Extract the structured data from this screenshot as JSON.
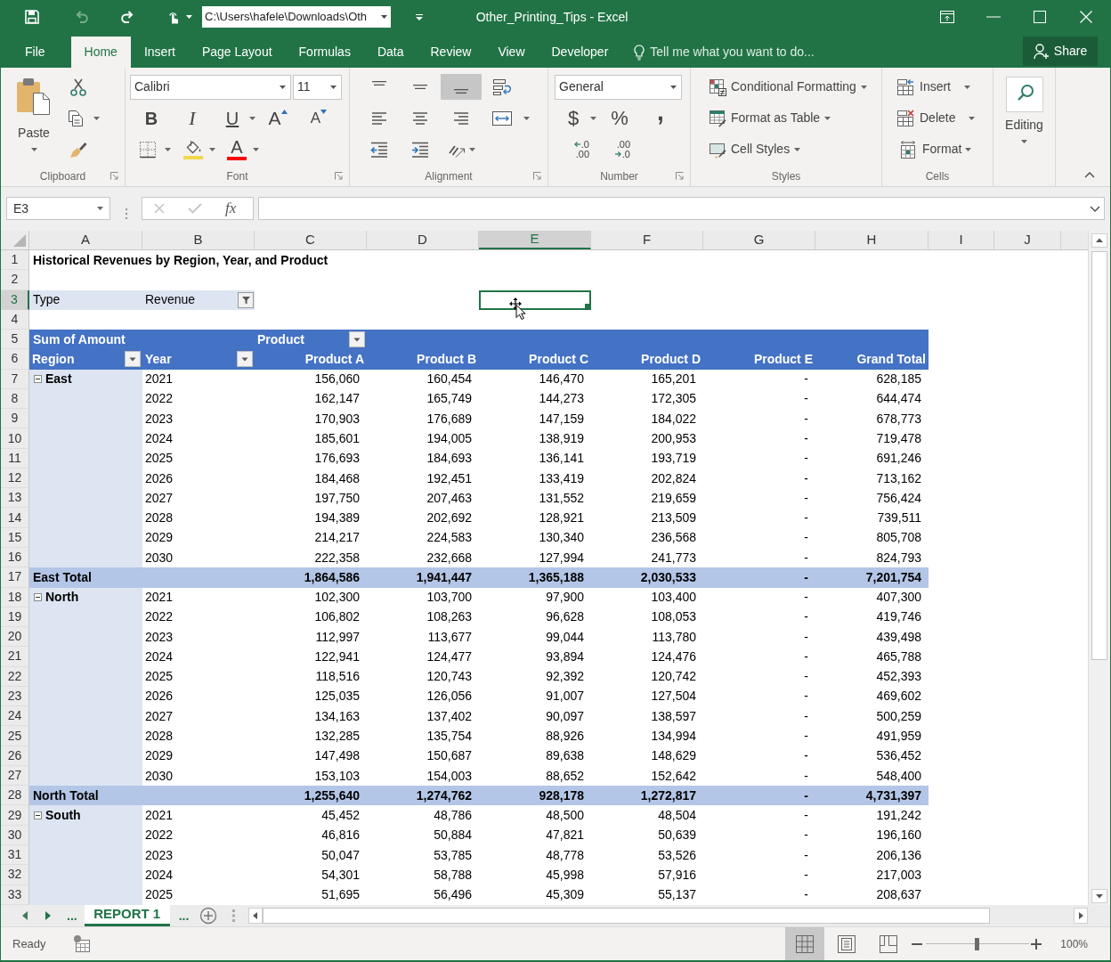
{
  "title_bar": {
    "quick_access": [
      {
        "kind": "save",
        "disabled": false
      },
      {
        "kind": "undo",
        "disabled": true
      },
      {
        "kind": "redo",
        "disabled": false
      },
      {
        "kind": "touch",
        "disabled": false
      }
    ],
    "path": "C:\\Users\\hafele\\Downloads\\Oth",
    "title": "Other_Printing_Tips - Excel"
  },
  "ribbon_tabs": [
    {
      "label": "File",
      "selected": false
    },
    {
      "label": "Home",
      "selected": true
    },
    {
      "label": "Insert",
      "selected": false
    },
    {
      "label": "Page Layout",
      "selected": false
    },
    {
      "label": "Formulas",
      "selected": false
    },
    {
      "label": "Data",
      "selected": false
    },
    {
      "label": "Review",
      "selected": false
    },
    {
      "label": "View",
      "selected": false
    },
    {
      "label": "Developer",
      "selected": false
    }
  ],
  "tell_me": {
    "placeholder": "Tell me what you want to do..."
  },
  "share_button": "Share",
  "ribbon": {
    "clipboard": {
      "label": "Clipboard",
      "paste": "Paste"
    },
    "font": {
      "label": "Font",
      "font_name": "Calibri",
      "font_size": "11",
      "buttons": [
        {
          "kind": "bold",
          "glyph": "B"
        },
        {
          "kind": "italic",
          "glyph": "I"
        },
        {
          "kind": "underline",
          "glyph": "U"
        },
        {
          "kind": "grow",
          "glyph": "A"
        },
        {
          "kind": "shrink",
          "glyph": "A"
        }
      ],
      "colors": [
        {
          "kind": "borders"
        },
        {
          "kind": "fill",
          "color": "#f0d84a"
        },
        {
          "kind": "font",
          "glyph": "A",
          "color": "#ff0000"
        }
      ]
    },
    "alignment": {
      "label": "Alignment",
      "vertical": [
        {
          "kind": "top",
          "selected": false
        },
        {
          "kind": "middle",
          "selected": false
        },
        {
          "kind": "bottom",
          "selected": true
        }
      ]
    },
    "number": {
      "label": "Number",
      "format": "General",
      "symbols": [
        {
          "kind": "currency",
          "glyph": "$"
        },
        {
          "kind": "percent",
          "glyph": "%"
        },
        {
          "kind": "comma",
          "glyph": ","
        }
      ],
      "decimals": [
        {
          "kind": "increase",
          "lines": [
            ".0",
            ".00"
          ]
        },
        {
          "kind": "decrease",
          "lines": [
            ".00",
            ".0"
          ]
        }
      ]
    },
    "styles": {
      "label": "Styles",
      "items": [
        {
          "kind": "conditional",
          "label": "Conditional Formatting"
        },
        {
          "kind": "table",
          "label": "Format as Table"
        },
        {
          "kind": "cell",
          "label": "Cell Styles"
        }
      ]
    },
    "cells": {
      "label": "Cells",
      "items": [
        {
          "kind": "insert",
          "label": "Insert"
        },
        {
          "kind": "delete",
          "label": "Delete"
        },
        {
          "kind": "format",
          "label": "Format"
        }
      ]
    },
    "editing": {
      "label": "Editing"
    }
  },
  "formula_bar": {
    "name_box": "E3",
    "buttons": [
      {
        "kind": "cancel",
        "disabled": true
      },
      {
        "kind": "enter",
        "disabled": true
      },
      {
        "kind": "function",
        "glyph": "fx",
        "disabled": false
      }
    ]
  },
  "columns": [
    {
      "label": "A",
      "selected": false
    },
    {
      "label": "B",
      "selected": false
    },
    {
      "label": "C",
      "selected": false
    },
    {
      "label": "D",
      "selected": false
    },
    {
      "label": "E",
      "selected": true
    },
    {
      "label": "F",
      "selected": false
    },
    {
      "label": "G",
      "selected": false
    },
    {
      "label": "H",
      "selected": false
    },
    {
      "label": "I",
      "selected": false
    },
    {
      "label": "J",
      "selected": false
    }
  ],
  "row_numbers": [
    {
      "label": "1",
      "selected": false
    },
    {
      "label": "2",
      "selected": false
    },
    {
      "label": "3",
      "selected": true
    },
    {
      "label": "4",
      "selected": false
    },
    {
      "label": "5",
      "selected": false
    },
    {
      "label": "6",
      "selected": false
    },
    {
      "label": "7",
      "selected": false
    },
    {
      "label": "8",
      "selected": false
    },
    {
      "label": "9",
      "selected": false
    },
    {
      "label": "10",
      "selected": false
    },
    {
      "label": "11",
      "selected": false
    },
    {
      "label": "12",
      "selected": false
    },
    {
      "label": "13",
      "selected": false
    },
    {
      "label": "14",
      "selected": false
    },
    {
      "label": "15",
      "selected": false
    },
    {
      "label": "16",
      "selected": false
    },
    {
      "label": "17",
      "selected": false
    },
    {
      "label": "18",
      "selected": false
    },
    {
      "label": "19",
      "selected": false
    },
    {
      "label": "20",
      "selected": false
    },
    {
      "label": "21",
      "selected": false
    },
    {
      "label": "22",
      "selected": false
    },
    {
      "label": "23",
      "selected": false
    },
    {
      "label": "24",
      "selected": false
    },
    {
      "label": "25",
      "selected": false
    },
    {
      "label": "26",
      "selected": false
    },
    {
      "label": "27",
      "selected": false
    },
    {
      "label": "28",
      "selected": false
    },
    {
      "label": "29",
      "selected": false
    },
    {
      "label": "30",
      "selected": false
    },
    {
      "label": "31",
      "selected": false
    },
    {
      "label": "32",
      "selected": false
    },
    {
      "label": "33",
      "selected": false
    }
  ],
  "sheet": {
    "title": "Historical Revenues by Region, Year, and Product",
    "report_filter": {
      "field": "Type",
      "value": "Revenue"
    },
    "pivot": {
      "value_field": "Sum of Amount",
      "column_field": "Product",
      "row_fields": [
        "Region",
        "Year"
      ],
      "columns": [
        "Product A",
        "Product B",
        "Product C",
        "Product D",
        "Product E",
        "Grand Total"
      ],
      "groups": [
        {
          "region": "East",
          "expanded": true,
          "rows": [
            {
              "year": "2021",
              "values": [
                "156,060",
                "160,454",
                "146,470",
                "165,201",
                "-",
                "628,185"
              ]
            },
            {
              "year": "2022",
              "values": [
                "162,147",
                "165,749",
                "144,273",
                "172,305",
                "-",
                "644,474"
              ]
            },
            {
              "year": "2023",
              "values": [
                "170,903",
                "176,689",
                "147,159",
                "184,022",
                "-",
                "678,773"
              ]
            },
            {
              "year": "2024",
              "values": [
                "185,601",
                "194,005",
                "138,919",
                "200,953",
                "-",
                "719,478"
              ]
            },
            {
              "year": "2025",
              "values": [
                "176,693",
                "184,693",
                "136,141",
                "193,719",
                "-",
                "691,246"
              ]
            },
            {
              "year": "2026",
              "values": [
                "184,468",
                "192,451",
                "133,419",
                "202,824",
                "-",
                "713,162"
              ]
            },
            {
              "year": "2027",
              "values": [
                "197,750",
                "207,463",
                "131,552",
                "219,659",
                "-",
                "756,424"
              ]
            },
            {
              "year": "2028",
              "values": [
                "194,389",
                "202,692",
                "128,921",
                "213,509",
                "-",
                "739,511"
              ]
            },
            {
              "year": "2029",
              "values": [
                "214,217",
                "224,583",
                "130,340",
                "236,568",
                "-",
                "805,708"
              ]
            },
            {
              "year": "2030",
              "values": [
                "222,358",
                "232,668",
                "127,994",
                "241,773",
                "-",
                "824,793"
              ]
            }
          ],
          "total": {
            "label": "East Total",
            "values": [
              "1,864,586",
              "1,941,447",
              "1,365,188",
              "2,030,533",
              "-",
              "7,201,754"
            ]
          }
        },
        {
          "region": "North",
          "expanded": true,
          "rows": [
            {
              "year": "2021",
              "values": [
                "102,300",
                "103,700",
                "97,900",
                "103,400",
                "-",
                "407,300"
              ]
            },
            {
              "year": "2022",
              "values": [
                "106,802",
                "108,263",
                "96,628",
                "108,053",
                "-",
                "419,746"
              ]
            },
            {
              "year": "2023",
              "values": [
                "112,997",
                "113,677",
                "99,044",
                "113,780",
                "-",
                "439,498"
              ]
            },
            {
              "year": "2024",
              "values": [
                "122,941",
                "124,477",
                "93,894",
                "124,476",
                "-",
                "465,788"
              ]
            },
            {
              "year": "2025",
              "values": [
                "118,516",
                "120,743",
                "92,392",
                "120,742",
                "-",
                "452,393"
              ]
            },
            {
              "year": "2026",
              "values": [
                "125,035",
                "126,056",
                "91,007",
                "127,504",
                "-",
                "469,602"
              ]
            },
            {
              "year": "2027",
              "values": [
                "134,163",
                "137,402",
                "90,097",
                "138,597",
                "-",
                "500,259"
              ]
            },
            {
              "year": "2028",
              "values": [
                "132,285",
                "135,754",
                "88,926",
                "134,994",
                "-",
                "491,959"
              ]
            },
            {
              "year": "2029",
              "values": [
                "147,498",
                "150,687",
                "89,638",
                "148,629",
                "-",
                "536,452"
              ]
            },
            {
              "year": "2030",
              "values": [
                "153,103",
                "154,003",
                "88,652",
                "152,642",
                "-",
                "548,400"
              ]
            }
          ],
          "total": {
            "label": "North Total",
            "values": [
              "1,255,640",
              "1,274,762",
              "928,178",
              "1,272,817",
              "-",
              "4,731,397"
            ]
          }
        },
        {
          "region": "South",
          "expanded": true,
          "rows": [
            {
              "year": "2021",
              "values": [
                "45,452",
                "48,786",
                "48,500",
                "48,504",
                "-",
                "191,242"
              ]
            },
            {
              "year": "2022",
              "values": [
                "46,816",
                "50,884",
                "47,821",
                "50,639",
                "-",
                "196,160"
              ]
            },
            {
              "year": "2023",
              "values": [
                "50,047",
                "53,785",
                "48,778",
                "53,526",
                "-",
                "206,136"
              ]
            },
            {
              "year": "2024",
              "values": [
                "54,301",
                "58,788",
                "45,998",
                "57,916",
                "-",
                "217,003"
              ]
            },
            {
              "year": "2025",
              "values": [
                "51,695",
                "56,496",
                "45,309",
                "55,137",
                "-",
                "208,637"
              ]
            }
          ]
        }
      ]
    }
  },
  "sheet_tabs": {
    "overflow_left": "...",
    "tabs": [
      {
        "label": "REPORT 1",
        "selected": true
      }
    ],
    "overflow_right": "..."
  },
  "status_bar": {
    "status": "Ready",
    "views": [
      {
        "kind": "normal",
        "selected": true
      },
      {
        "kind": "page_layout",
        "selected": false
      },
      {
        "kind": "page_break",
        "selected": false
      }
    ],
    "zoom": {
      "level": 0.49,
      "label": "100%"
    }
  }
}
